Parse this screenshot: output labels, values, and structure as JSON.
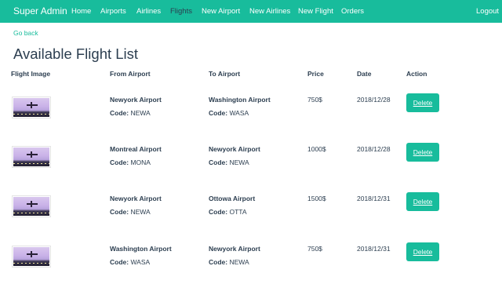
{
  "navbar": {
    "brand": "Super Admin",
    "links": [
      {
        "label": "Home"
      },
      {
        "label": "Airports"
      },
      {
        "label": "Airlines"
      },
      {
        "label": "Flights"
      },
      {
        "label": "New Airport"
      },
      {
        "label": "New Airlines"
      },
      {
        "label": "New Flight"
      },
      {
        "label": "Orders"
      }
    ],
    "active": "Flights",
    "logout": "Logout"
  },
  "go_back": "Go back",
  "page_title": "Available Flight List",
  "table": {
    "headers": [
      "Flight Image",
      "From Airport",
      "To Airport",
      "Price",
      "Date",
      "Action"
    ],
    "code_label": "Code:",
    "delete_label": "Delete",
    "rows": [
      {
        "from_name": "Newyork Airport",
        "from_code": "NEWA",
        "to_name": "Washington Airport",
        "to_code": "WASA",
        "price": "750$",
        "date": "2018/12/28"
      },
      {
        "from_name": "Montreal Airport",
        "from_code": "MONA",
        "to_name": "Newyork Airport",
        "to_code": "NEWA",
        "price": "1000$",
        "date": "2018/12/28"
      },
      {
        "from_name": "Newyork Airport",
        "from_code": "NEWA",
        "to_name": "Ottowa Airport",
        "to_code": "OTTA",
        "price": "1500$",
        "date": "2018/12/31"
      },
      {
        "from_name": "Washington Airport",
        "from_code": "WASA",
        "to_name": "Newyork Airport",
        "to_code": "NEWA",
        "price": "750$",
        "date": "2018/12/31"
      }
    ]
  },
  "colors": {
    "accent": "#18bc9c",
    "text": "#2c3e50"
  }
}
